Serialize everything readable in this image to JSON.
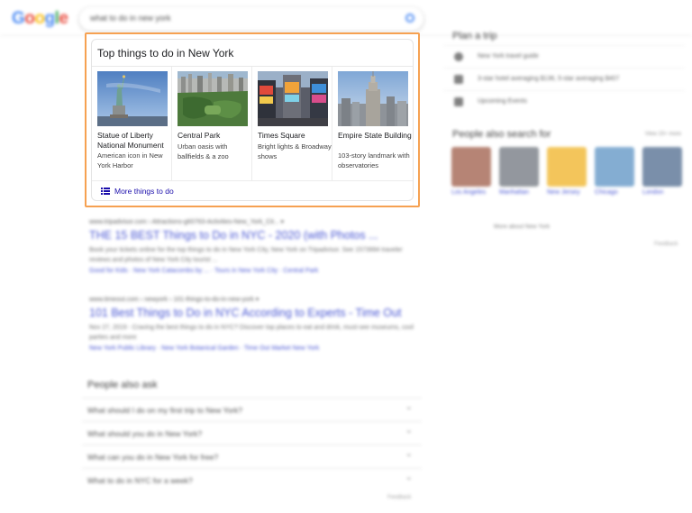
{
  "header": {
    "logo_letters": [
      {
        "ch": "G",
        "color": "#4285f4"
      },
      {
        "ch": "o",
        "color": "#ea4335"
      },
      {
        "ch": "o",
        "color": "#fbbc05"
      },
      {
        "ch": "g",
        "color": "#4285f4"
      },
      {
        "ch": "l",
        "color": "#34a853"
      },
      {
        "ch": "e",
        "color": "#ea4335"
      }
    ],
    "search_query": "what to do in new york"
  },
  "card": {
    "title": "Top things to do in New York",
    "attractions": [
      {
        "name": "Statue of Liberty National Monument",
        "desc": "American icon in New York Harbor",
        "icon": "statue-of-liberty-photo"
      },
      {
        "name": "Central Park",
        "desc": "Urban oasis with ballfields & a zoo",
        "icon": "central-park-photo"
      },
      {
        "name": "Times Square",
        "desc": "Bright lights & Broadway shows",
        "icon": "times-square-photo"
      },
      {
        "name": "Empire State Building",
        "desc": "103-story landmark with observatories",
        "icon": "empire-state-building-photo"
      }
    ],
    "more_label": "More things to do",
    "more_icon": "list-icon",
    "highlight_color": "#f6a151"
  },
  "results": [
    {
      "url": "www.tripadvisor.com › Attractions-g60763-Activities-New_York_Cit... ▾",
      "title": "THE 15 BEST Things to Do in NYC - 2020 (with Photos ...",
      "snippet": "Book your tickets online for the top things to do in New York City, New York on Tripadvisor. See 1573994 traveler reviews and photos of New York City tourist ...",
      "links": "Good for Kids · New York Catacombs by ... · Tours in New York City · Central Park"
    },
    {
      "url": "www.timeout.com › newyork › 101-things-to-do-in-new-york ▾",
      "title": "101 Best Things to Do in NYC According to Experts - Time Out",
      "snippet": "Nov 27, 2019 - Craving the best things to do in NYC? Discover top places to eat and drink, must-see museums, cool parties and more",
      "links": "New York Public Library · New York Botanical Garden · Time Out Market New York"
    }
  ],
  "people_also_ask": {
    "heading": "People also ask",
    "questions": [
      "What should I do on my first trip to New York?",
      "What should you do in New York?",
      "What can you do in New York for free?",
      "What to do in NYC for a week?"
    ],
    "feedback": "Feedback"
  },
  "right_panel": {
    "plan_heading": "Plan a trip",
    "plan_items": [
      {
        "label": "New York travel guide",
        "icon": "globe-icon"
      },
      {
        "label": "3-star hotel averaging $136, 5-star averaging $407",
        "icon": "bed-icon"
      },
      {
        "label": "Upcoming Events",
        "icon": "calendar-icon"
      }
    ],
    "also_search_heading": "People also search for",
    "view_more": "View 15+ more",
    "cities": [
      {
        "name": "Los Angeles",
        "color": "#b07a6a"
      },
      {
        "name": "Manhattan",
        "color": "#8a8f96"
      },
      {
        "name": "New Jersey",
        "color": "#f2c14e"
      },
      {
        "name": "Chicago",
        "color": "#7aa7cf"
      },
      {
        "name": "London",
        "color": "#6f86a3"
      }
    ],
    "more_about": "More about New York",
    "feedback": "Feedback"
  }
}
